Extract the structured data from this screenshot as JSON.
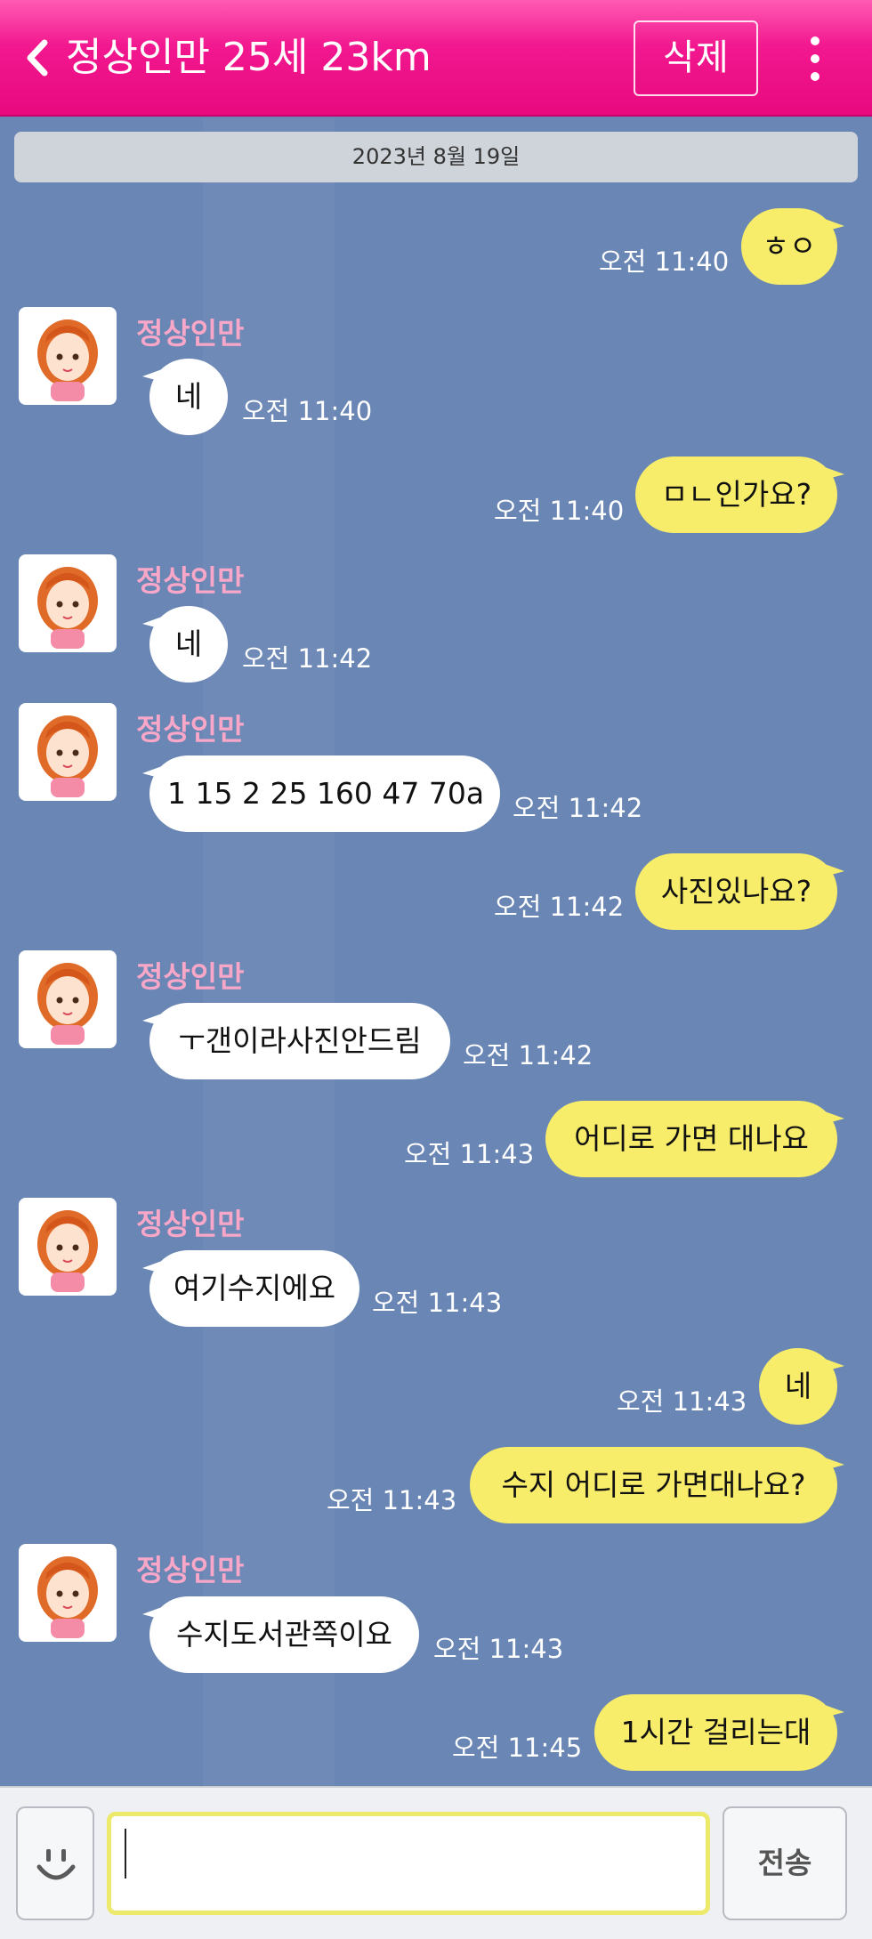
{
  "header": {
    "title": "정상인만 25세 23km",
    "delete_label": "삭제"
  },
  "chat": {
    "date": "2023년 8월 19일",
    "messages": [
      {
        "from": "me",
        "text": "ㅎㅇ",
        "time": "오전 11:40"
      },
      {
        "from": "them",
        "sender": "정상인만",
        "text": "네",
        "time": "오전 11:40"
      },
      {
        "from": "me",
        "text": "ㅁㄴ인가요?",
        "time": "오전 11:40"
      },
      {
        "from": "them",
        "sender": "정상인만",
        "text": "네",
        "time": "오전 11:42"
      },
      {
        "from": "them",
        "sender": "정상인만",
        "text": "1 15 2 25 160 47 70a",
        "time": "오전 11:42"
      },
      {
        "from": "me",
        "text": "사진있나요?",
        "time": "오전 11:42"
      },
      {
        "from": "them",
        "sender": "정상인만",
        "text": "ㅜ갠이라사진안드림",
        "time": "오전 11:42"
      },
      {
        "from": "me",
        "text": "어디로 가면 대나요",
        "time": "오전 11:43"
      },
      {
        "from": "them",
        "sender": "정상인만",
        "text": "여기수지에요",
        "time": "오전 11:43"
      },
      {
        "from": "me",
        "text": "네",
        "time": "오전 11:43"
      },
      {
        "from": "me",
        "text": "수지 어디로 가면대나요?",
        "time": "오전 11:43"
      },
      {
        "from": "them",
        "sender": "정상인만",
        "text": "수지도서관쪽이요",
        "time": "오전 11:43"
      },
      {
        "from": "me",
        "text": "1시간 걸리는대",
        "time": "오전 11:45"
      }
    ]
  },
  "input": {
    "value": "",
    "send_label": "전송"
  },
  "colors": {
    "header": "#ee1289",
    "background": "#6a86b4",
    "sent_bubble": "#f7ed6a",
    "received_bubble": "#ffffff",
    "sender_name": "#f9a7c8"
  },
  "icons": {
    "back": "chevron-left-icon",
    "more": "vertical-dots-icon",
    "emoji": "smiley-icon",
    "avatar": "girl-avatar-icon"
  }
}
